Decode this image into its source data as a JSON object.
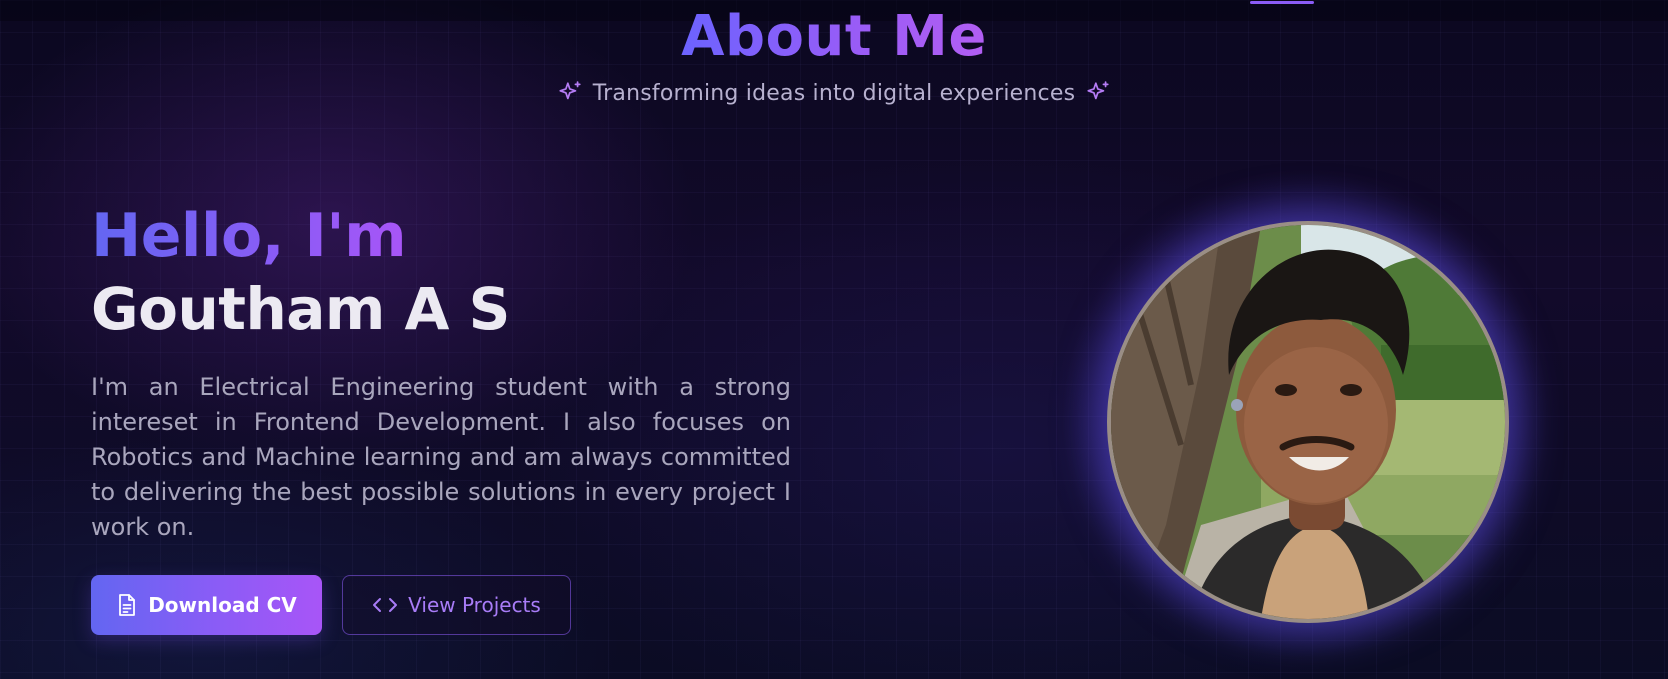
{
  "header": {
    "section_title": "About Me",
    "subtitle": "Transforming ideas into digital experiences",
    "subtitle_icon": "sparkles-icon"
  },
  "intro": {
    "greeting": "Hello, I'm",
    "name": "Goutham A S",
    "bio": "I'm an Electrical Engineering student with a strong intereset in Frontend Development. I also focuses on Robotics and Machine learning and am always committed to delivering the best possible solutions in every project I work on."
  },
  "actions": {
    "download_cv": {
      "label": "Download CV",
      "icon": "document-icon"
    },
    "view_projects": {
      "label": "View Projects",
      "icon": "code-icon"
    }
  },
  "profile_photo": {
    "alt": "Portrait photo"
  },
  "colors": {
    "accent_start": "#6366f1",
    "accent_end": "#a855f7",
    "background": "#0a0718",
    "text_primary": "#eceaf2",
    "text_secondary": "#a9a6bd"
  }
}
